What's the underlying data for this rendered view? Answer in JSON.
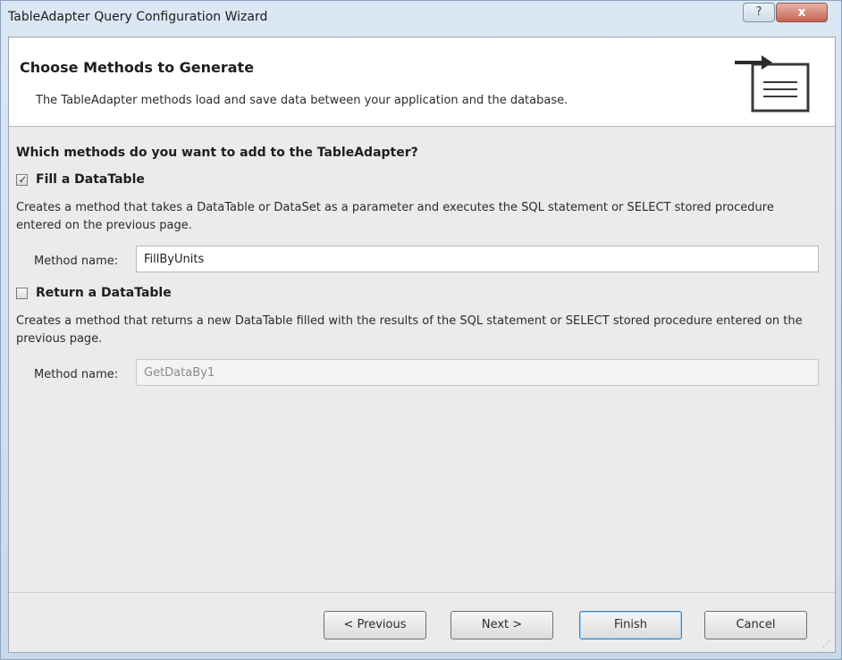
{
  "window": {
    "title": "TableAdapter Query Configuration Wizard",
    "help_label": "?",
    "close_label": "x"
  },
  "header": {
    "title": "Choose Methods to Generate",
    "subtitle": "The TableAdapter methods load and save data between your application and the database."
  },
  "body": {
    "question": "Which methods do you want to add to the TableAdapter?",
    "fill": {
      "checked": true,
      "label": "Fill a DataTable",
      "description": "Creates a method that takes a DataTable or DataSet as a parameter and executes the SQL statement or SELECT stored procedure entered on the previous page.",
      "method_label": "Method name:",
      "method_value": "FillByUnits"
    },
    "return": {
      "checked": false,
      "label": "Return a DataTable",
      "description": "Creates a method that returns a new DataTable filled with the results of the SQL statement or SELECT stored procedure entered on the previous page.",
      "method_label": "Method name:",
      "method_value": "GetDataBy1"
    }
  },
  "buttons": {
    "previous": "< Previous",
    "next": "Next >",
    "finish": "Finish",
    "cancel": "Cancel"
  },
  "icons": {
    "wizard": "arrow-into-table-icon",
    "check": "checkmark-icon",
    "grip": "resize-grip-icon"
  },
  "colors": {
    "title_bar": "#dbe7f3",
    "close_button": "#c4614f",
    "header_background": "#ffffff",
    "body_background": "#ebebeb",
    "finish_focus": "#3c7fb1"
  }
}
